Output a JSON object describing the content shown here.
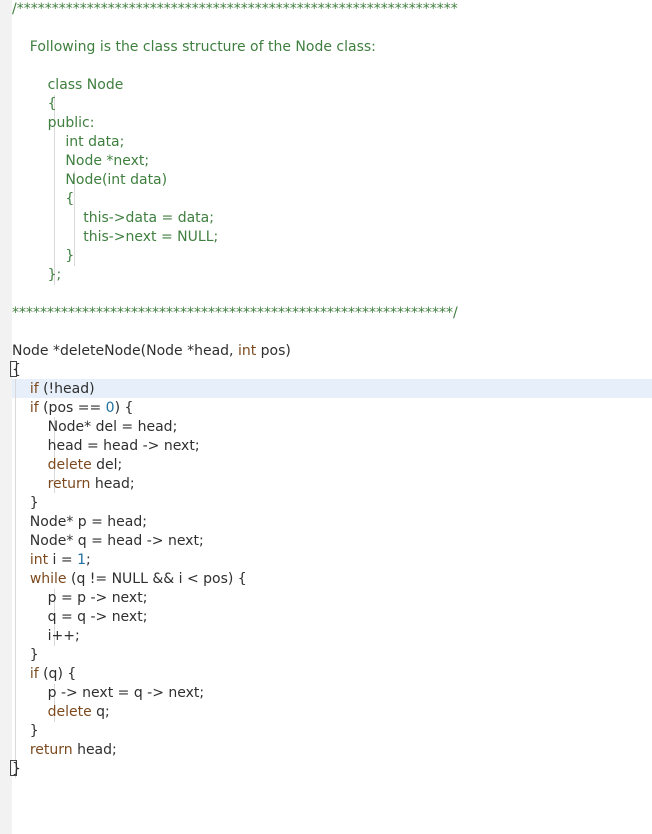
{
  "code": {
    "lines": [
      "/***************************************************************",
      "",
      "    Following is the class structure of the Node class:",
      "",
      "        class Node",
      "        {",
      "        public:",
      "            int data;",
      "            Node *next;",
      "            Node(int data)",
      "            {",
      "                this->data = data;",
      "                this->next = NULL;",
      "            }",
      "        };",
      "",
      "***************************************************************/",
      "",
      "Node *deleteNode(Node *head, int pos)",
      "{",
      "    if (!head)",
      "    if (pos == 0) {",
      "        Node* del = head;",
      "        head = head -> next;",
      "        delete del;",
      "        return head;",
      "    }",
      "    Node* p = head;",
      "    Node* q = head -> next;",
      "    int i = 1;",
      "    while (q != NULL && i < pos) {",
      "        p = p -> next;",
      "        q = q -> next;",
      "        i++;",
      "    }",
      "    if (q) {",
      "        p -> next = q -> next;",
      "        delete q;",
      "    }",
      "    return head;",
      "}"
    ]
  },
  "colors": {
    "comment": "#3f7f3f",
    "keyword": "#7c4a1e",
    "number": "#1f6f9f",
    "text": "#2f2f2f",
    "active_line": "#e7f0fa"
  }
}
